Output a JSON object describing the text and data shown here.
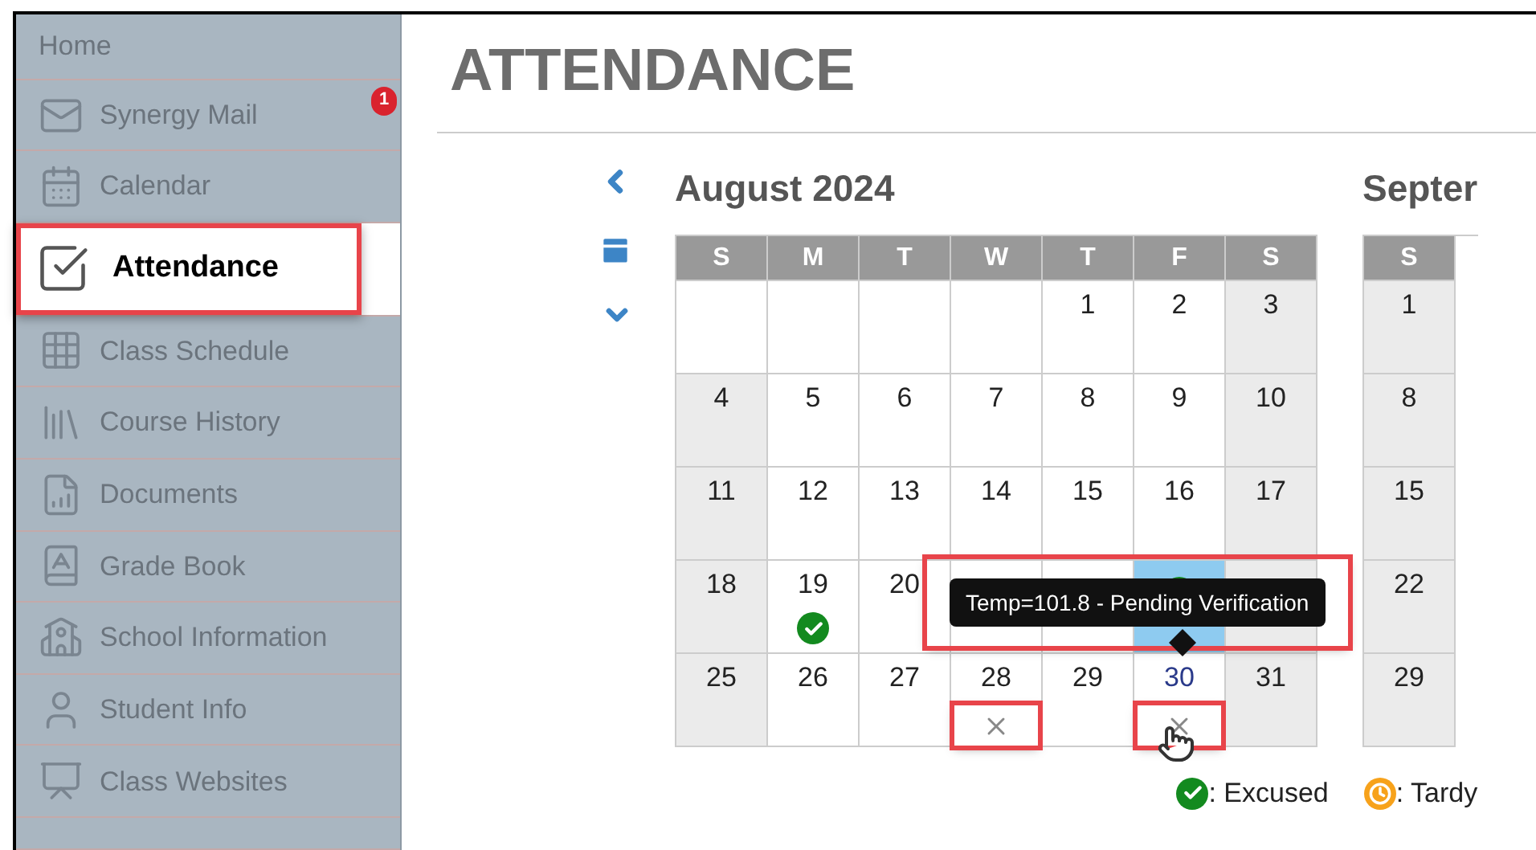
{
  "sidebar": {
    "items": [
      {
        "label": "Home",
        "selected": false
      },
      {
        "label": "Synergy Mail",
        "selected": false,
        "badge": "1"
      },
      {
        "label": "Calendar",
        "selected": false
      },
      {
        "label": "Attendance",
        "selected": true,
        "annotated": true
      },
      {
        "label": "Class Schedule",
        "selected": false
      },
      {
        "label": "Course History",
        "selected": false
      },
      {
        "label": "Documents",
        "selected": false
      },
      {
        "label": "Grade Book",
        "selected": false
      },
      {
        "label": "School Information",
        "selected": false
      },
      {
        "label": "Student Info",
        "selected": false
      },
      {
        "label": "Class Websites",
        "selected": false
      }
    ]
  },
  "page_title": "ATTENDANCE",
  "months": [
    {
      "title": "August 2024",
      "weekdays": [
        "S",
        "M",
        "T",
        "W",
        "T",
        "F",
        "S"
      ],
      "weeks": [
        [
          {
            "weekend": false,
            "selected": false
          },
          {
            "weekend": false,
            "selected": false
          },
          {
            "weekend": false,
            "selected": false
          },
          {
            "weekend": false,
            "selected": false
          },
          {
            "day": "1",
            "weekend": false,
            "selected": false
          },
          {
            "day": "2",
            "weekend": false,
            "selected": false
          },
          {
            "day": "3",
            "weekend": true,
            "selected": false
          }
        ],
        [
          {
            "day": "4",
            "weekend": true,
            "selected": false
          },
          {
            "day": "5",
            "weekend": false,
            "selected": false
          },
          {
            "day": "6",
            "weekend": false,
            "selected": false
          },
          {
            "day": "7",
            "weekend": false,
            "selected": false
          },
          {
            "day": "8",
            "weekend": false,
            "selected": false
          },
          {
            "day": "9",
            "weekend": false,
            "selected": false
          },
          {
            "day": "10",
            "weekend": true,
            "selected": false
          }
        ],
        [
          {
            "day": "11",
            "weekend": true,
            "selected": false
          },
          {
            "day": "12",
            "weekend": false,
            "selected": false
          },
          {
            "day": "13",
            "weekend": false,
            "selected": false
          },
          {
            "day": "14",
            "weekend": false,
            "selected": false
          },
          {
            "day": "15",
            "weekend": false,
            "selected": false
          },
          {
            "day": "16",
            "weekend": false,
            "selected": false
          },
          {
            "day": "17",
            "weekend": true,
            "selected": false
          }
        ],
        [
          {
            "day": "18",
            "weekend": true,
            "selected": false
          },
          {
            "day": "19",
            "weekend": false,
            "selected": false,
            "mark": {
              "kind": "excused"
            }
          },
          {
            "day": "20",
            "weekend": false,
            "selected": false
          },
          {
            "weekend": false,
            "selected": false
          },
          {
            "weekend": false,
            "selected": false
          },
          {
            "selected": true,
            "mark": {
              "kind": "excused"
            }
          },
          {
            "weekend": true,
            "selected": false
          }
        ],
        [
          {
            "day": "25",
            "weekend": true,
            "selected": false
          },
          {
            "day": "26",
            "weekend": false,
            "selected": false
          },
          {
            "day": "27",
            "weekend": false,
            "selected": false
          },
          {
            "day": "28",
            "weekend": false,
            "selected": false,
            "mark": {
              "kind": "absent",
              "annotated": true,
              "hovered": false
            }
          },
          {
            "day": "29",
            "weekend": false,
            "selected": false
          },
          {
            "day": "30",
            "link": true,
            "weekend": false,
            "selected": false,
            "mark": {
              "kind": "absent",
              "annotated": true,
              "hovered": true
            }
          },
          {
            "day": "31",
            "weekend": true,
            "selected": false
          }
        ]
      ]
    },
    {
      "title": "Septer",
      "weekdays": [
        "S"
      ],
      "weeks": [
        [
          {
            "day": "1",
            "weekend": true,
            "selected": false
          }
        ],
        [
          {
            "day": "8",
            "weekend": true,
            "selected": false
          }
        ],
        [
          {
            "day": "15",
            "weekend": true,
            "selected": false
          }
        ],
        [
          {
            "day": "22",
            "weekend": true,
            "selected": false
          }
        ],
        [
          {
            "day": "29",
            "weekend": true,
            "selected": false
          }
        ]
      ]
    }
  ],
  "tooltip": {
    "text": "Temp=101.8 - Pending Verification",
    "annotated": true
  },
  "legend": [
    {
      "kind": "excused",
      "label": ": Excused"
    },
    {
      "kind": "tardy",
      "label": ": Tardy"
    }
  ]
}
